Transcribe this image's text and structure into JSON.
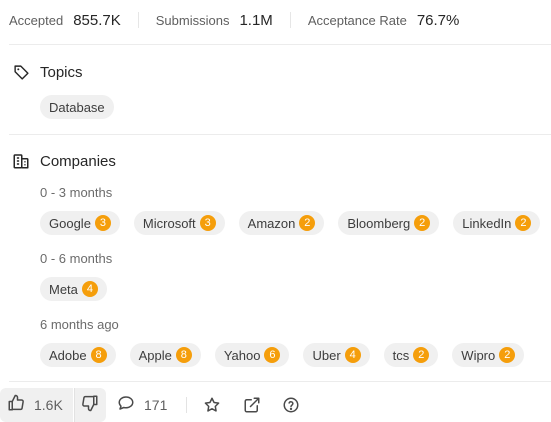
{
  "stats": {
    "accepted_label": "Accepted",
    "accepted_value": "855.7K",
    "submissions_label": "Submissions",
    "submissions_value": "1.1M",
    "acceptance_rate_label": "Acceptance Rate",
    "acceptance_rate_value": "76.7%"
  },
  "topics": {
    "title": "Topics",
    "icon": "tag-icon",
    "tags": [
      "Database"
    ]
  },
  "companies": {
    "title": "Companies",
    "icon": "building-icon",
    "groups": [
      {
        "period": "0 - 3 months",
        "items": [
          {
            "name": "Google",
            "count": "3"
          },
          {
            "name": "Microsoft",
            "count": "3"
          },
          {
            "name": "Amazon",
            "count": "2"
          },
          {
            "name": "Bloomberg",
            "count": "2"
          },
          {
            "name": "LinkedIn",
            "count": "2"
          }
        ]
      },
      {
        "period": "0 - 6 months",
        "items": [
          {
            "name": "Meta",
            "count": "4"
          }
        ]
      },
      {
        "period": "6 months ago",
        "items": [
          {
            "name": "Adobe",
            "count": "8"
          },
          {
            "name": "Apple",
            "count": "8"
          },
          {
            "name": "Yahoo",
            "count": "6"
          },
          {
            "name": "Uber",
            "count": "4"
          },
          {
            "name": "tcs",
            "count": "2"
          },
          {
            "name": "Wipro",
            "count": "2"
          }
        ]
      }
    ]
  },
  "toolbar": {
    "like_count": "1.6K",
    "comment_count": "171",
    "icons": [
      "thumbs-up-icon",
      "thumbs-down-icon",
      "comment-icon",
      "star-icon",
      "external-link-icon",
      "help-icon"
    ]
  },
  "colors": {
    "badge": "#f59e0b",
    "chip_bg": "#f0f0f0"
  }
}
